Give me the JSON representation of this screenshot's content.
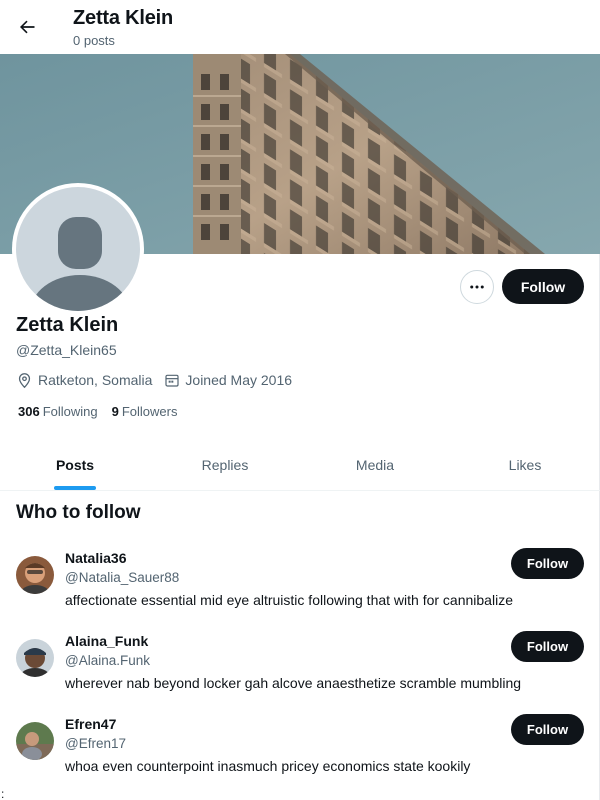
{
  "header": {
    "name": "Zetta Klein",
    "posts_count": "0 posts",
    "back_icon": "arrow-left-icon"
  },
  "profile": {
    "name": "Zetta Klein",
    "handle": "@Zetta_Klein65",
    "location": "Ratketon, Somalia",
    "joined": "Joined May 2016",
    "following_count": "306",
    "following_label": "Following",
    "followers_count": "9",
    "followers_label": "Followers",
    "follow_label": "Follow",
    "more_icon": "more-horizontal-icon"
  },
  "tabs": [
    {
      "label": "Posts",
      "active": true
    },
    {
      "label": "Replies",
      "active": false
    },
    {
      "label": "Media",
      "active": false
    },
    {
      "label": "Likes",
      "active": false
    }
  ],
  "who_to_follow": {
    "title": "Who to follow",
    "users": [
      {
        "name": "Natalia36",
        "handle": "@Natalia_Sauer88",
        "bio": "affectionate essential mid eye altruistic following that with for cannibalize",
        "follow_label": "Follow"
      },
      {
        "name": "Alaina_Funk",
        "handle": "@Alaina.Funk",
        "bio": "wherever nab beyond locker gah alcove anaesthetize scramble mumbling",
        "follow_label": "Follow"
      },
      {
        "name": "Efren47",
        "handle": "@Efren17",
        "bio": "whoa even counterpoint inasmuch pricey economics state kookily",
        "follow_label": "Follow"
      }
    ]
  },
  "stray_text": ":",
  "colors": {
    "accent": "#1d9bf0",
    "button_dark": "#0f1419",
    "secondary_text": "#536471"
  }
}
